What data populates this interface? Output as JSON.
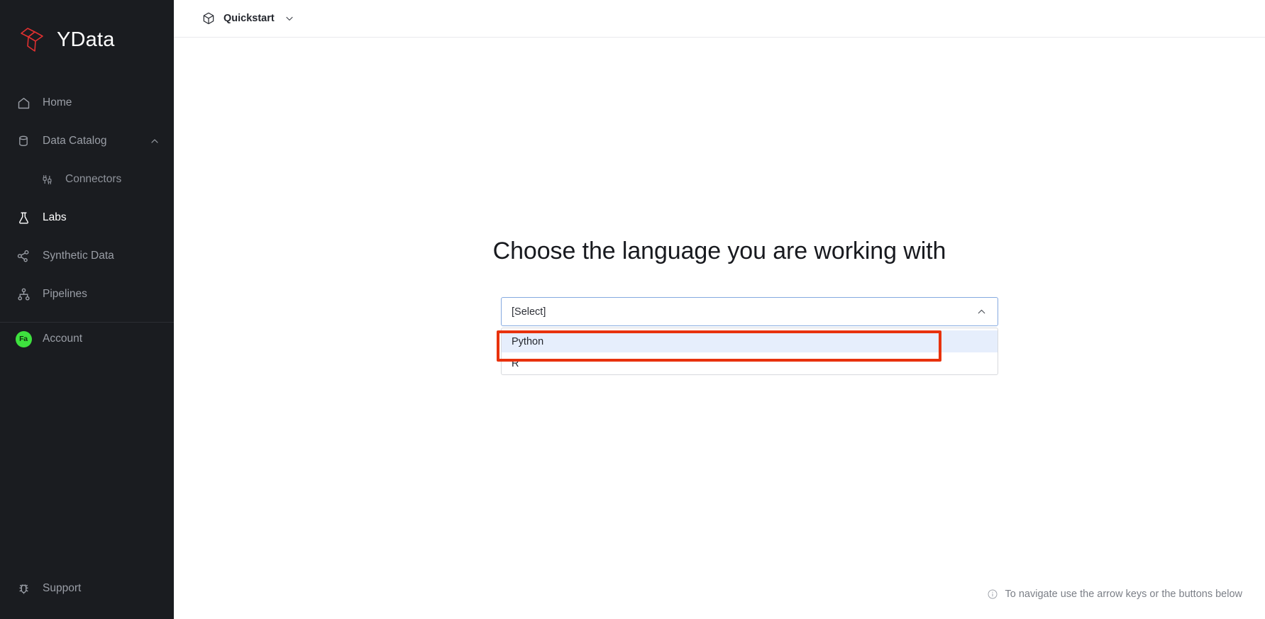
{
  "brand": {
    "name": "YData",
    "logo_color": "#e03030"
  },
  "sidebar": {
    "items": [
      {
        "label": "Home",
        "icon": "home-icon"
      },
      {
        "label": "Data Catalog",
        "icon": "database-icon",
        "chevron": "chevron-up-icon"
      },
      {
        "label": "Connectors",
        "icon": "connectors-icon"
      },
      {
        "label": "Labs",
        "icon": "flask-icon",
        "active": true
      },
      {
        "label": "Synthetic Data",
        "icon": "share-nodes-icon"
      },
      {
        "label": "Pipelines",
        "icon": "pipeline-icon"
      },
      {
        "label": "Account",
        "icon": "avatar",
        "avatar_initials": "Fa",
        "avatar_color": "#3ee13e"
      },
      {
        "label": "Support",
        "icon": "bug-icon"
      }
    ]
  },
  "topbar": {
    "breadcrumb_label": "Quickstart",
    "breadcrumb_icon": "cube-icon",
    "caret_icon": "chevron-down-icon"
  },
  "main": {
    "title": "Choose the language you are working with",
    "select": {
      "value": "[Select]",
      "caret_icon": "chevron-up-icon",
      "expanded": true,
      "options": [
        {
          "label": "Python",
          "highlighted": true,
          "annotated": true
        },
        {
          "label": "R",
          "highlighted": false,
          "annotated": false
        }
      ]
    },
    "hint": {
      "icon": "info-icon",
      "text": "To navigate use the arrow keys or the buttons below"
    }
  },
  "annotation": {
    "color": "#e8320d",
    "target": "Python"
  }
}
